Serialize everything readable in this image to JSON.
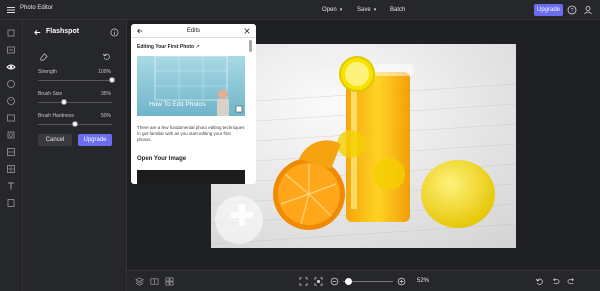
{
  "app": {
    "title": "Photo Editor"
  },
  "toolbar": {
    "open_label": "Open",
    "save_label": "Save",
    "batch_label": "Batch",
    "upgrade_label": "Upgrade"
  },
  "panel": {
    "title": "Flashspot",
    "sliders": [
      {
        "label": "Strength",
        "value_text": "100%",
        "value": 1.0
      },
      {
        "label": "Brush Size",
        "value_text": "35%",
        "value": 0.35
      },
      {
        "label": "Brush Hardness",
        "value_text": "50%",
        "value": 0.5
      }
    ],
    "cancel_label": "Cancel",
    "upgrade_label": "Upgrade"
  },
  "edits": {
    "title": "Edits",
    "section1": "Editing Your First Photo",
    "thumb_caption": "How To Edit Photos",
    "paragraph": "There are a few fundamental photo editing techniques to get familiar with as you start editing your first photos.",
    "section2": "Open Your Image"
  },
  "bottom": {
    "zoom_text": "52%"
  },
  "colors": {
    "accent": "#6c6cf0",
    "background": "#1f2023",
    "panel": "#26272b"
  }
}
